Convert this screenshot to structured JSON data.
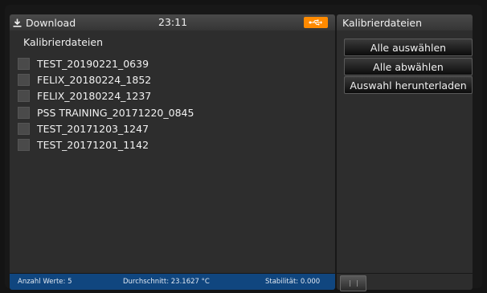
{
  "top_bar": {
    "download_label": "Download",
    "time": "23:11",
    "usb_icon": "usb-icon",
    "usb_color": "#ff8a00"
  },
  "file_panel": {
    "title": "Kalibrierdateien",
    "files": [
      {
        "label": "TEST_20190221_0639",
        "checked": false
      },
      {
        "label": "FELIX_20180224_1852",
        "checked": false
      },
      {
        "label": "FELIX_20180224_1237",
        "checked": false
      },
      {
        "label": "PSS TRAINING_20171220_0845",
        "checked": false
      },
      {
        "label": "TEST_20171203_1247",
        "checked": false
      },
      {
        "label": "TEST_20171201_1142",
        "checked": false
      }
    ]
  },
  "status_bar": {
    "count": "Anzahl Werte: 5",
    "average": "Durchschnitt: 23.1627 °C",
    "stability": "Stabilität: 0.000",
    "color": "#10467f"
  },
  "side_panel": {
    "title": "Kalibrierdateien",
    "select_all": "Alle auswählen",
    "deselect_all": "Alle abwählen",
    "download_selection": "Auswahl herunterladen"
  }
}
